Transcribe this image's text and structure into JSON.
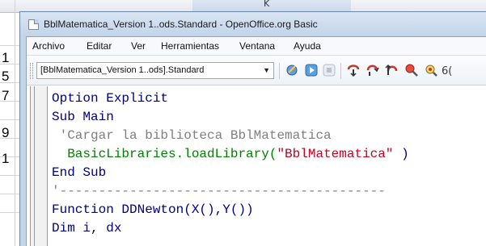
{
  "background_sheet": {
    "column_header": "K",
    "row_digits": [
      "1",
      "5",
      "7",
      "9",
      "1"
    ]
  },
  "window": {
    "title": "BblMatematica_Version 1..ods.Standard - OpenOffice.org Basic"
  },
  "menubar": {
    "items": [
      "Archivo",
      "Editar",
      "Ver",
      "Herramientas",
      "Ventana",
      "Ayuda"
    ]
  },
  "toolbar": {
    "library_select_value": "[BblMatematica_Version 1..ods].Standard",
    "buttons": [
      "select-module",
      "run",
      "stop",
      "step-into",
      "step-over",
      "step-out",
      "breakpoint",
      "watch",
      "find-parentheses"
    ]
  },
  "editor": {
    "lines": [
      {
        "tokens": [
          {
            "t": "Option Explicit",
            "c": "kw"
          }
        ]
      },
      {
        "tokens": [
          {
            "t": "Sub Main",
            "c": "kw"
          }
        ]
      },
      {
        "tokens": [
          {
            "t": " 'Cargar la biblioteca BblMatematica",
            "c": "tok-comment"
          }
        ]
      },
      {
        "tokens": [
          {
            "t": "  BasicLibraries.loadLibrary(",
            "c": "tok-ident"
          },
          {
            "t": "\"BblMatematica\"",
            "c": "tok-string"
          },
          {
            "t": " )",
            "c": "tok-plain"
          }
        ]
      },
      {
        "tokens": [
          {
            "t": "End Sub",
            "c": "kw"
          }
        ]
      },
      {
        "tokens": [
          {
            "t": "'------------------------------------------",
            "c": "tok-dash"
          }
        ]
      },
      {
        "tokens": [
          {
            "t": "Function DDNewton(X(),Y())",
            "c": "kw"
          }
        ]
      },
      {
        "tokens": [
          {
            "t": "Dim i, dx",
            "c": "kw"
          }
        ]
      }
    ]
  }
}
